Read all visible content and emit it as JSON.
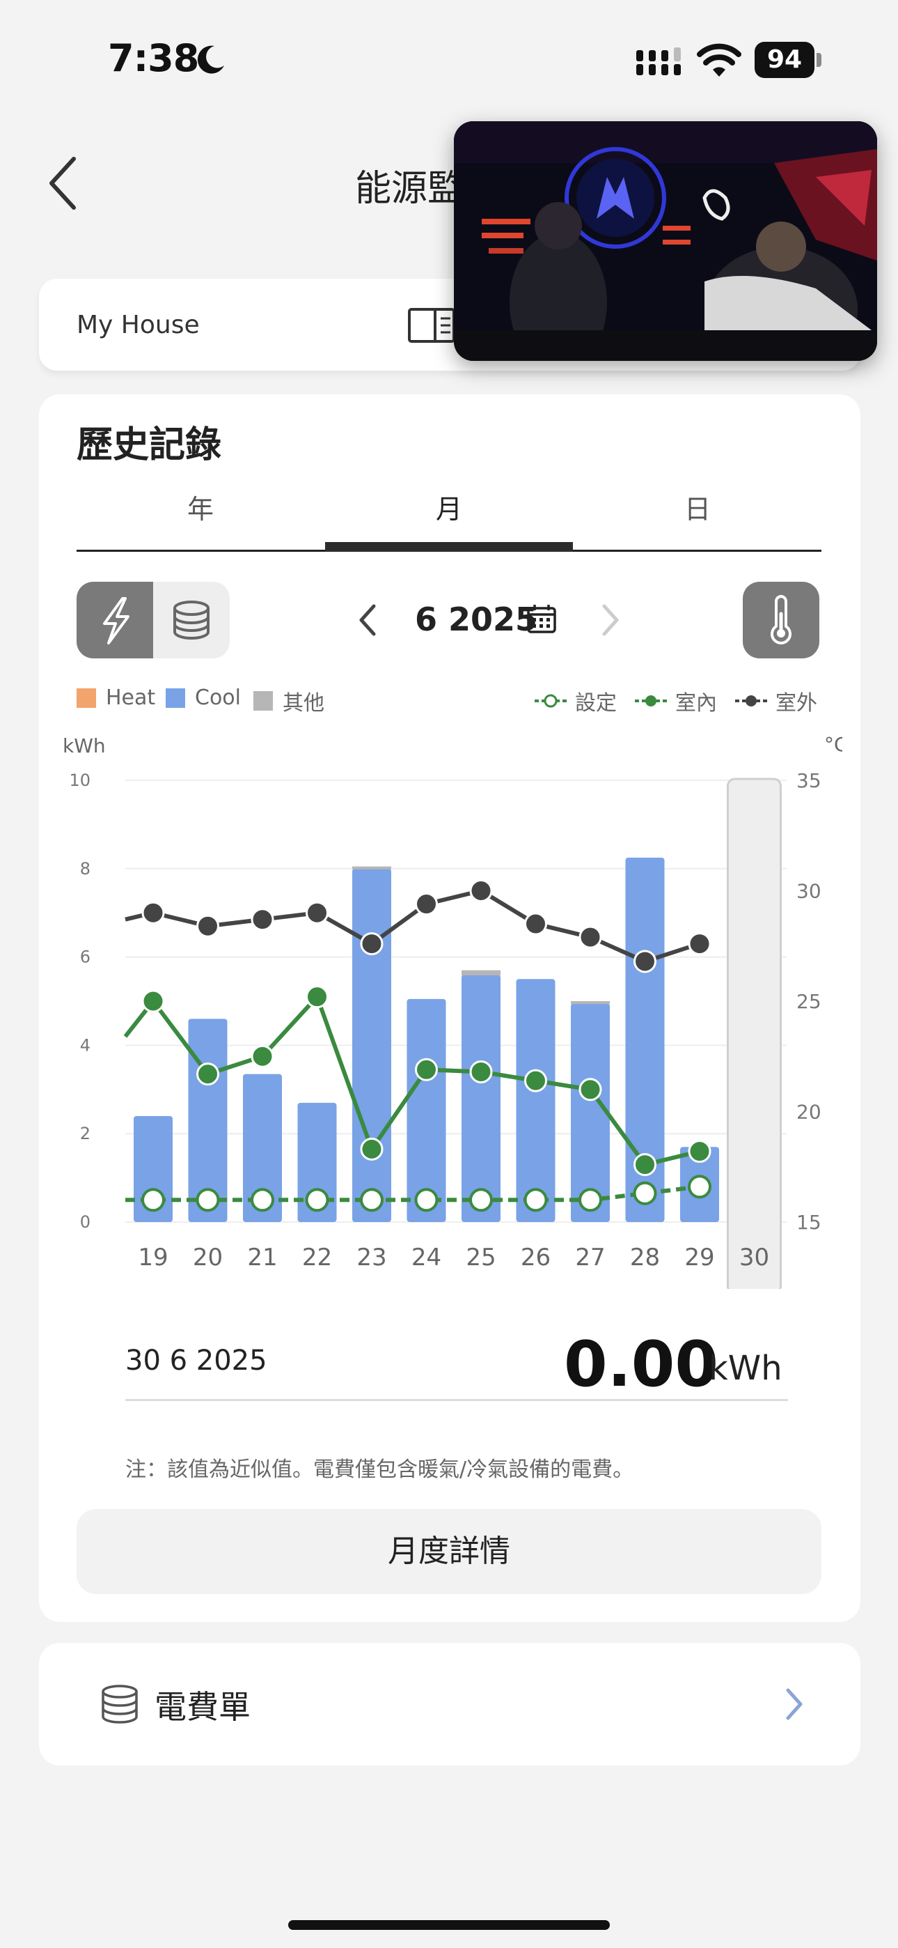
{
  "status_bar": {
    "time": "7:38",
    "battery": "94"
  },
  "header": {
    "title": "能源監"
  },
  "house": {
    "name": "My House"
  },
  "history": {
    "title": "歷史記錄",
    "tabs": [
      "年",
      "月",
      "日"
    ],
    "active_tab": "月",
    "period": "6 2025",
    "legend_left": [
      "Heat",
      "Cool",
      "其他"
    ],
    "legend_right": [
      "設定",
      "室內",
      "室外"
    ]
  },
  "colors": {
    "heat": "#f2a46c",
    "cool": "#7aa2e6",
    "other": "#b6b6b6",
    "set": "#3a8a3f",
    "indoor": "#3a8a3f",
    "outdoor": "#444444"
  },
  "chart_data": {
    "type": "bar",
    "categories": [
      "19",
      "20",
      "21",
      "22",
      "23",
      "24",
      "25",
      "26",
      "27",
      "28",
      "29",
      "30"
    ],
    "y_left_label": "kWh",
    "y_right_label": "°C",
    "y_left_ticks": [
      "10",
      "8",
      "6",
      "4",
      "2",
      "0"
    ],
    "y_right_ticks": [
      "35",
      "30",
      "25",
      "20",
      "15"
    ],
    "ylim_left": [
      0,
      10
    ],
    "ylim_right": [
      15,
      35
    ],
    "grid": true,
    "selected_category": "30",
    "series": [
      {
        "name": "Cool",
        "kind": "bar",
        "values": [
          2.4,
          4.6,
          3.35,
          2.7,
          8.0,
          5.05,
          5.6,
          5.5,
          4.95,
          8.25,
          1.7,
          0
        ]
      },
      {
        "name": "其他",
        "kind": "bar",
        "values": [
          0,
          0,
          0,
          0,
          0.05,
          0,
          0.1,
          0,
          0.05,
          0,
          0,
          0
        ]
      },
      {
        "name": "設定",
        "kind": "line",
        "values": [
          16.0,
          16.0,
          16.0,
          16.0,
          16.0,
          16.0,
          16.0,
          16.0,
          16.0,
          16.3,
          16.6,
          null
        ],
        "start_value": 16.0
      },
      {
        "name": "室內",
        "kind": "line",
        "values": [
          25.0,
          21.7,
          22.5,
          25.2,
          18.3,
          21.9,
          21.8,
          21.4,
          21.0,
          17.6,
          18.2,
          null
        ],
        "start_value": 23.4
      },
      {
        "name": "室外",
        "kind": "line",
        "values": [
          29.0,
          28.4,
          28.7,
          29.0,
          27.6,
          29.4,
          30.0,
          28.5,
          27.9,
          26.8,
          27.6,
          null
        ],
        "start_value": 28.7
      }
    ]
  },
  "selection": {
    "date": "30 6 2025",
    "value": "0.00",
    "unit": "kWh"
  },
  "note": "注：該值為近似值。電費僅包含暖氣/冷氣設備的電費。",
  "monthly_detail_label": "月度詳情",
  "bill": {
    "label": "電費單"
  }
}
